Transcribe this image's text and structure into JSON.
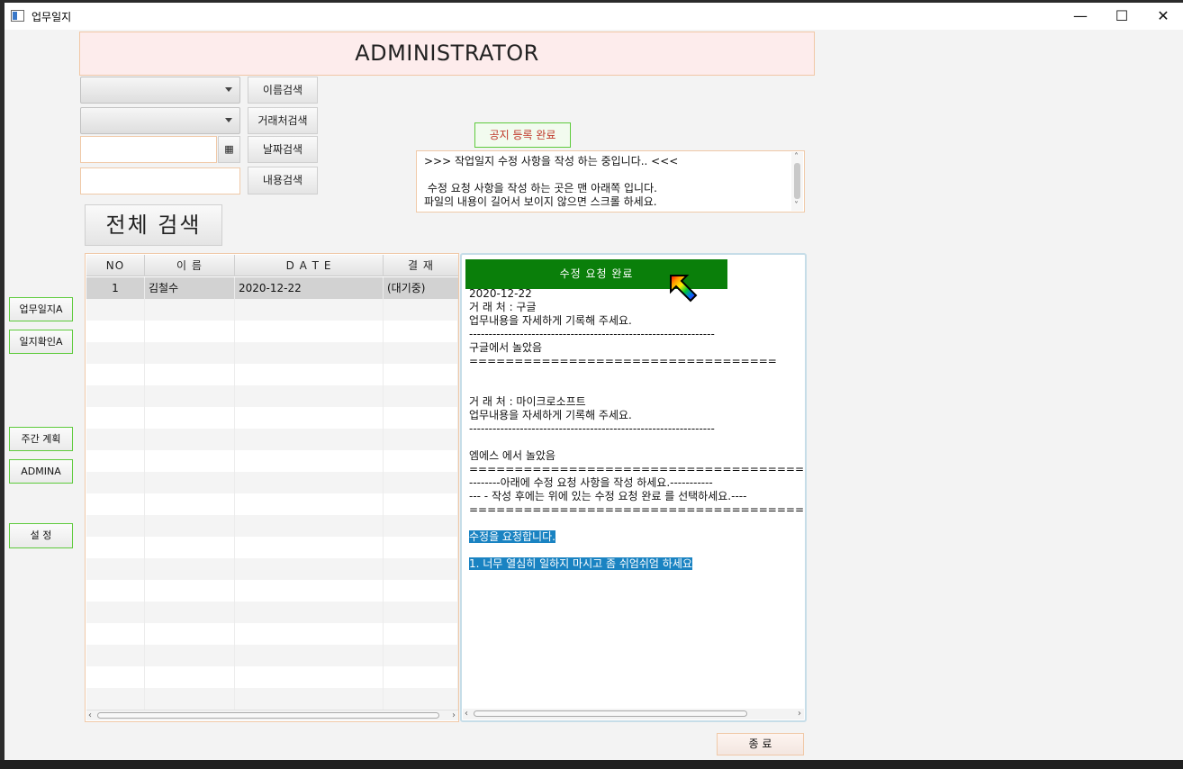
{
  "window": {
    "title": "업무일지",
    "minimize": "—",
    "maximize": "☐",
    "close": "✕"
  },
  "header": {
    "title": "ADMINISTRATOR"
  },
  "search": {
    "name_button": "이름검색",
    "client_button": "거래처검색",
    "date_button": "날짜검색",
    "content_button": "내용검색",
    "all_button": "전체 검색",
    "calendar_icon": "▦"
  },
  "notice": {
    "status_label": "공지 등록 완료",
    "text": ">>> 작업일지 수정 사항을 작성 하는 중입니다.. <<<\n\n 수정 요청 사항을 작성 하는 곳은 맨 아래쪽 입니다.\n파일의 내용이 길어서 보이지 않으면 스크롤 하세요."
  },
  "sidebar": {
    "items": [
      {
        "label": "업무일지A"
      },
      {
        "label": "일지확인A"
      },
      {
        "label": "주간 계획"
      },
      {
        "label": "ADMINA"
      },
      {
        "label": "설   정"
      }
    ]
  },
  "table": {
    "columns": [
      "NO",
      "이   름",
      "D  A  T  E",
      "결  재"
    ],
    "rows": [
      {
        "no": "1",
        "name": "김철수",
        "date": "2020-12-22",
        "status": "(대기중)"
      }
    ]
  },
  "detail": {
    "complete_button": "수정   요청   완료",
    "lines": [
      "2020-12-22",
      "거 래 처 : 구글",
      "업무내용을 자세하게 기록해 주세요.",
      "---------------------------------------------------------------",
      "구글에서 놀았음",
      "==================================",
      "",
      "",
      "거 래 처 : 마이크로소프트",
      "업무내용을 자세하게 기록해 주세요.",
      "---------------------------------------------------------------",
      "",
      "엠에스 에서 놀았음",
      "=======================================",
      "--------아래에 수정 요청 사항을 작성 하세요.-----------",
      "--- - 작성 후에는 위에 있는 수정 요청 완료 를 선택하세요.----",
      "======================================="
    ],
    "highlight_lines": [
      "수정을 요청합니다.",
      "1. 너무 열심히 일하지 마시고 좀 쉬엄쉬엄 하세요"
    ]
  },
  "footer": {
    "close_button": "종   료"
  },
  "icons": {
    "scroll_left": "‹",
    "scroll_right": "›",
    "scroll_up": "˄",
    "scroll_down": "˅"
  }
}
